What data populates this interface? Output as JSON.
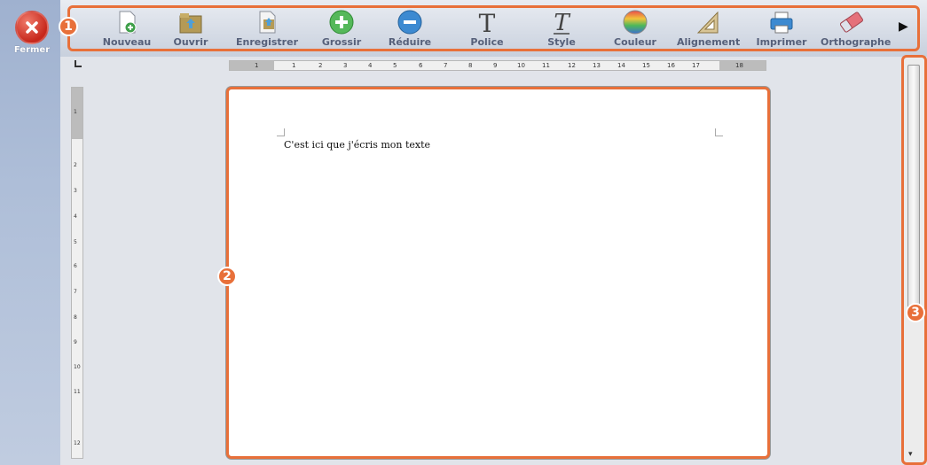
{
  "sidebar": {
    "close_label": "Fermer"
  },
  "toolbar": {
    "items": [
      {
        "label": "Nouveau",
        "icon": "new-document-icon"
      },
      {
        "label": "Ouvrir",
        "icon": "open-folder-icon"
      },
      {
        "label": "Enregistrer",
        "icon": "save-icon"
      },
      {
        "label": "Grossir",
        "icon": "zoom-in-icon"
      },
      {
        "label": "Réduire",
        "icon": "zoom-out-icon"
      },
      {
        "label": "Police",
        "icon": "font-icon"
      },
      {
        "label": "Style",
        "icon": "style-icon"
      },
      {
        "label": "Couleur",
        "icon": "color-icon"
      },
      {
        "label": "Alignement",
        "icon": "alignment-icon"
      },
      {
        "label": "Imprimer",
        "icon": "printer-icon"
      },
      {
        "label": "Orthographe",
        "icon": "eraser-icon"
      }
    ],
    "more_arrow": "▶"
  },
  "markers": {
    "m1": "1",
    "m2": "2",
    "m3": "3"
  },
  "ruler": {
    "h_ticks": [
      "1",
      "1",
      "2",
      "3",
      "4",
      "5",
      "6",
      "7",
      "8",
      "9",
      "10",
      "11",
      "12",
      "13",
      "14",
      "15",
      "16",
      "17",
      "18"
    ],
    "v_ticks": [
      "1",
      "2",
      "3",
      "4",
      "5",
      "6",
      "7",
      "8",
      "9",
      "10",
      "11",
      "12"
    ]
  },
  "document": {
    "text": "C'est ici que j'écris mon texte"
  },
  "colors": {
    "accent": "#e8703a",
    "close": "#c7281c"
  }
}
